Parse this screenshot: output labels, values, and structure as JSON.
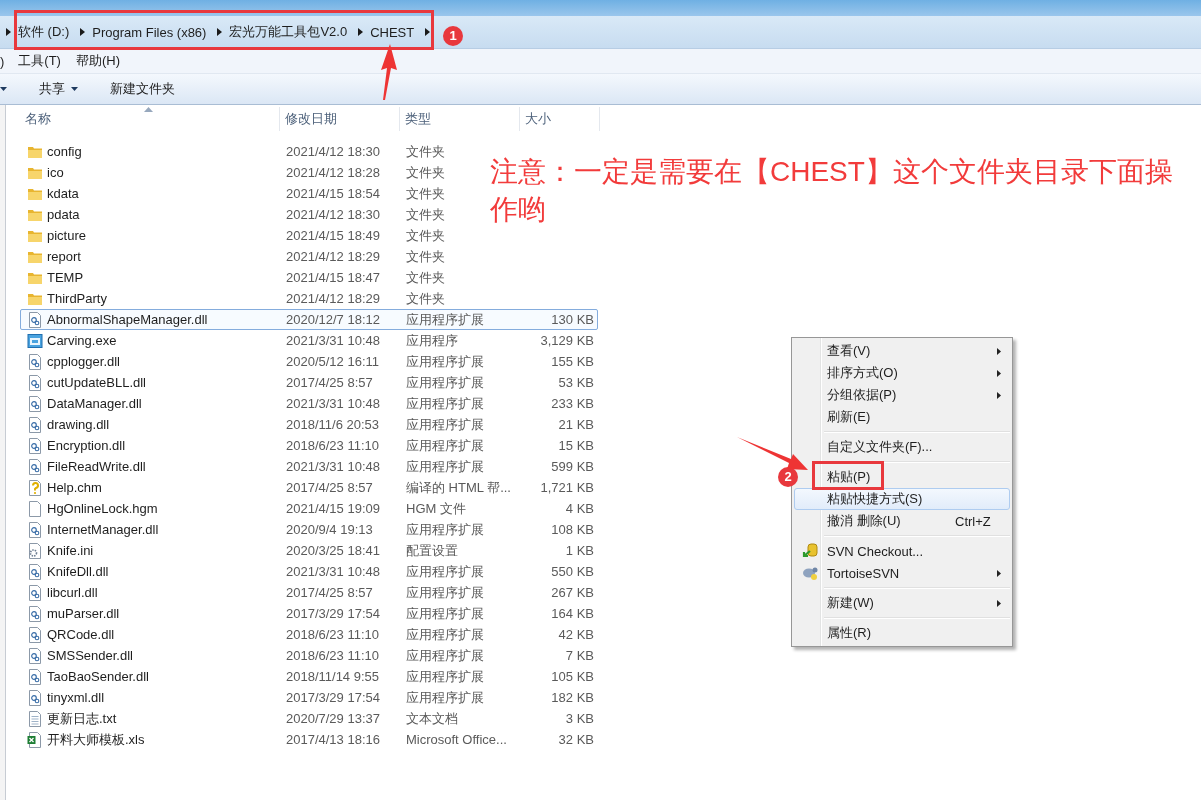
{
  "breadcrumb": [
    {
      "label": "软件 (D:)"
    },
    {
      "label": "Program Files (x86)"
    },
    {
      "label": "宏光万能工具包V2.0"
    },
    {
      "label": "CHEST"
    }
  ],
  "menu_bar": [
    ")",
    "工具(T)",
    "帮助(H)"
  ],
  "toolbar": [
    {
      "label": "共享",
      "dropdown": true
    },
    {
      "label": "新建文件夹",
      "dropdown": false
    }
  ],
  "columns": [
    {
      "label": "名称",
      "sorted": true
    },
    {
      "label": "修改日期",
      "sorted": false
    },
    {
      "label": "类型",
      "sorted": false
    },
    {
      "label": "大小",
      "sorted": false
    }
  ],
  "files": [
    {
      "kind": "folder",
      "name": "config",
      "date": "2021/4/12 18:30",
      "type": "文件夹",
      "selected": false
    },
    {
      "kind": "folder",
      "name": "ico",
      "date": "2021/4/12 18:28",
      "type": "文件夹",
      "selected": false
    },
    {
      "kind": "folder",
      "name": "kdata",
      "date": "2021/4/15 18:54",
      "type": "文件夹",
      "selected": false
    },
    {
      "kind": "folder",
      "name": "pdata",
      "date": "2021/4/12 18:30",
      "type": "文件夹",
      "selected": false
    },
    {
      "kind": "folder",
      "name": "picture",
      "date": "2021/4/15 18:49",
      "type": "文件夹",
      "selected": false
    },
    {
      "kind": "folder",
      "name": "report",
      "date": "2021/4/12 18:29",
      "type": "文件夹",
      "selected": false
    },
    {
      "kind": "folder",
      "name": "TEMP",
      "date": "2021/4/15 18:47",
      "type": "文件夹",
      "selected": false
    },
    {
      "kind": "folder",
      "name": "ThirdParty",
      "date": "2021/4/12 18:29",
      "type": "文件夹",
      "selected": false
    },
    {
      "kind": "dll",
      "name": "AbnormalShapeManager.dll",
      "date": "2020/12/7 18:12",
      "type": "应用程序扩展",
      "size": "130 KB",
      "selected": true
    },
    {
      "kind": "exe",
      "name": "Carving.exe",
      "date": "2021/3/31 10:48",
      "type": "应用程序",
      "size": "3,129 KB",
      "selected": false
    },
    {
      "kind": "dll",
      "name": "cpplogger.dll",
      "date": "2020/5/12 16:11",
      "type": "应用程序扩展",
      "size": "155 KB",
      "selected": false
    },
    {
      "kind": "dll",
      "name": "cutUpdateBLL.dll",
      "date": "2017/4/25 8:57",
      "type": "应用程序扩展",
      "size": "53 KB",
      "selected": false
    },
    {
      "kind": "dll",
      "name": "DataManager.dll",
      "date": "2021/3/31 10:48",
      "type": "应用程序扩展",
      "size": "233 KB",
      "selected": false
    },
    {
      "kind": "dll",
      "name": "drawing.dll",
      "date": "2018/11/6 20:53",
      "type": "应用程序扩展",
      "size": "21 KB",
      "selected": false
    },
    {
      "kind": "dll",
      "name": "Encryption.dll",
      "date": "2018/6/23 11:10",
      "type": "应用程序扩展",
      "size": "15 KB",
      "selected": false
    },
    {
      "kind": "dll",
      "name": "FileReadWrite.dll",
      "date": "2021/3/31 10:48",
      "type": "应用程序扩展",
      "size": "599 KB",
      "selected": false
    },
    {
      "kind": "chm",
      "name": "Help.chm",
      "date": "2017/4/25 8:57",
      "type": "编译的 HTML 帮...",
      "size": "1,721 KB",
      "selected": false
    },
    {
      "kind": "blank",
      "name": "HgOnlineLock.hgm",
      "date": "2021/4/15 19:09",
      "type": "HGM 文件",
      "size": "4 KB",
      "selected": false
    },
    {
      "kind": "dll",
      "name": "InternetManager.dll",
      "date": "2020/9/4 19:13",
      "type": "应用程序扩展",
      "size": "108 KB",
      "selected": false
    },
    {
      "kind": "ini",
      "name": "Knife.ini",
      "date": "2020/3/25 18:41",
      "type": "配置设置",
      "size": "1 KB",
      "selected": false
    },
    {
      "kind": "dll",
      "name": "KnifeDll.dll",
      "date": "2021/3/31 10:48",
      "type": "应用程序扩展",
      "size": "550 KB",
      "selected": false
    },
    {
      "kind": "dll",
      "name": "libcurl.dll",
      "date": "2017/4/25 8:57",
      "type": "应用程序扩展",
      "size": "267 KB",
      "selected": false
    },
    {
      "kind": "dll",
      "name": "muParser.dll",
      "date": "2017/3/29 17:54",
      "type": "应用程序扩展",
      "size": "164 KB",
      "selected": false
    },
    {
      "kind": "dll",
      "name": "QRCode.dll",
      "date": "2018/6/23 11:10",
      "type": "应用程序扩展",
      "size": "42 KB",
      "selected": false
    },
    {
      "kind": "dll",
      "name": "SMSSender.dll",
      "date": "2018/6/23 11:10",
      "type": "应用程序扩展",
      "size": "7 KB",
      "selected": false
    },
    {
      "kind": "dll",
      "name": "TaoBaoSender.dll",
      "date": "2018/11/14 9:55",
      "type": "应用程序扩展",
      "size": "105 KB",
      "selected": false
    },
    {
      "kind": "dll",
      "name": "tinyxml.dll",
      "date": "2017/3/29 17:54",
      "type": "应用程序扩展",
      "size": "182 KB",
      "selected": false
    },
    {
      "kind": "txt",
      "name": "更新日志.txt",
      "date": "2020/7/29 13:37",
      "type": "文本文档",
      "size": "3 KB",
      "selected": false
    },
    {
      "kind": "xls",
      "name": "开料大师模板.xls",
      "date": "2017/4/13 18:16",
      "type": "Microsoft Office...",
      "size": "32 KB",
      "selected": false
    }
  ],
  "context_menu": [
    {
      "kind": "item",
      "label": "查看(V)",
      "submenu": true,
      "hovered": false
    },
    {
      "kind": "item",
      "label": "排序方式(O)",
      "submenu": true,
      "hovered": false
    },
    {
      "kind": "item",
      "label": "分组依据(P)",
      "submenu": true,
      "hovered": false
    },
    {
      "kind": "item",
      "label": "刷新(E)",
      "submenu": false,
      "hovered": false
    },
    {
      "kind": "separator"
    },
    {
      "kind": "item",
      "label": "自定义文件夹(F)...",
      "submenu": false,
      "hovered": false
    },
    {
      "kind": "separator"
    },
    {
      "kind": "item",
      "label": "粘贴(P)",
      "submenu": false,
      "hovered": false
    },
    {
      "kind": "item",
      "label": "粘贴快捷方式(S)",
      "submenu": false,
      "hovered": true
    },
    {
      "kind": "item",
      "label": "撤消 删除(U)",
      "shortcut": "Ctrl+Z",
      "submenu": false,
      "hovered": false
    },
    {
      "kind": "separator"
    },
    {
      "kind": "checkout",
      "label": "SVN Checkout...",
      "submenu": false,
      "hovered": false
    },
    {
      "kind": "svn",
      "label": "TortoiseSVN",
      "submenu": true,
      "hovered": false
    },
    {
      "kind": "separator"
    },
    {
      "kind": "item",
      "label": "新建(W)",
      "submenu": true,
      "hovered": false
    },
    {
      "kind": "separator"
    },
    {
      "kind": "item",
      "label": "属性(R)",
      "submenu": false,
      "hovered": false
    }
  ],
  "annotations": {
    "note": "注意：一定是需要在【CHEST】这个文件夹目录下面操作哟",
    "badges": [
      "1",
      "2"
    ]
  }
}
